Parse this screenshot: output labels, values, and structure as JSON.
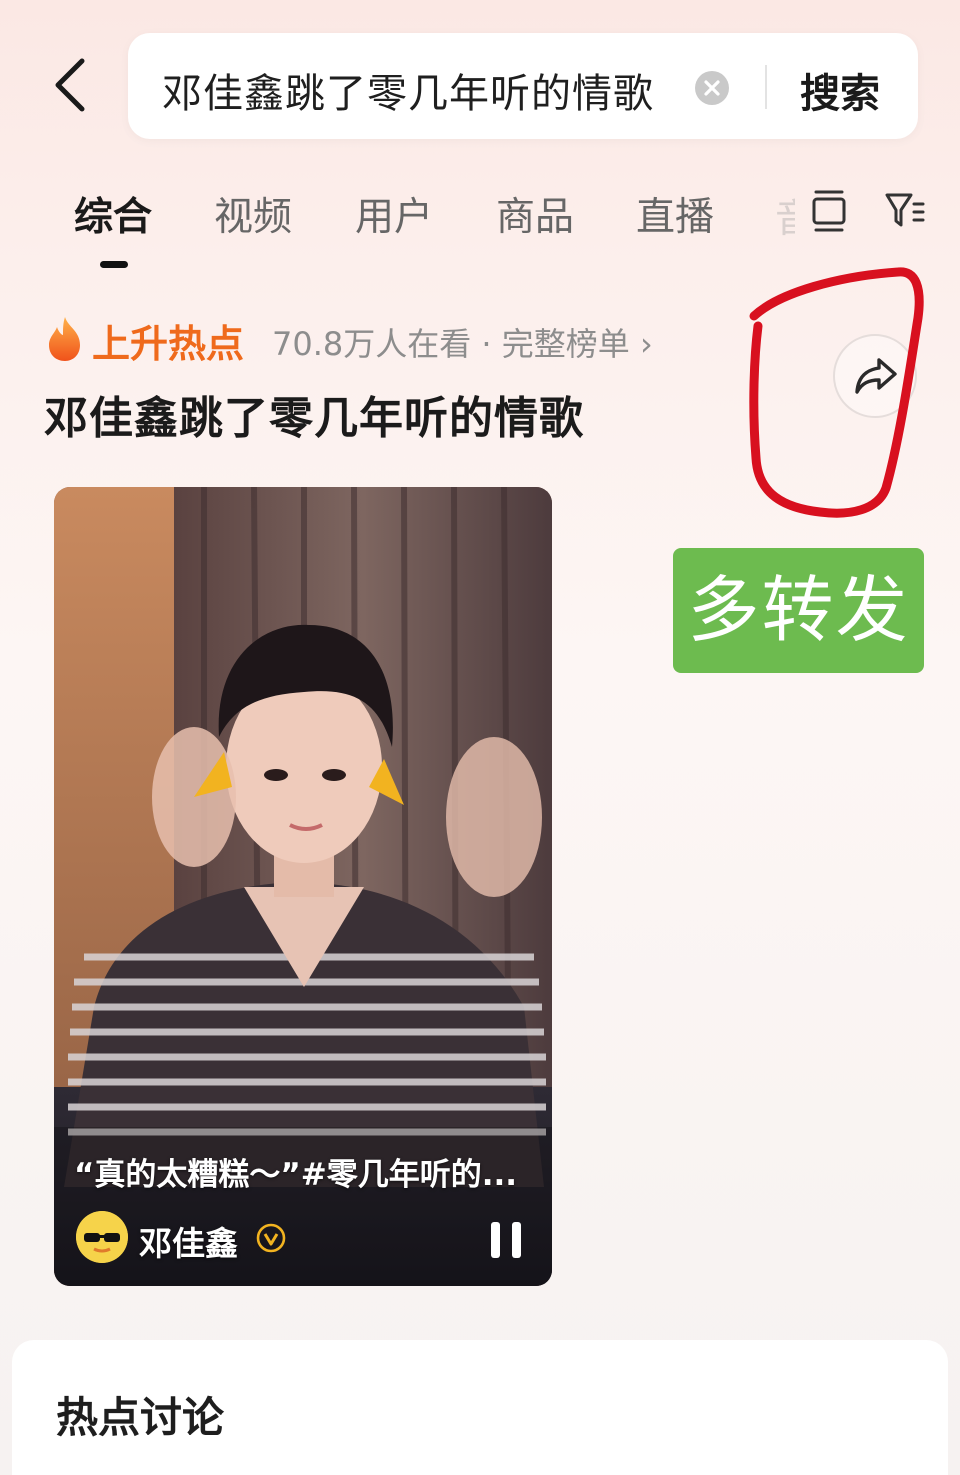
{
  "search": {
    "query": "邓佳鑫跳了零几年听的情歌",
    "submit_label": "搜索"
  },
  "tabs": [
    {
      "label": "综合",
      "active": true
    },
    {
      "label": "视频",
      "active": false
    },
    {
      "label": "用户",
      "active": false
    },
    {
      "label": "商品",
      "active": false
    },
    {
      "label": "直播",
      "active": false
    },
    {
      "label": "音",
      "active": false
    }
  ],
  "hot_topic": {
    "badge": "上升热点",
    "viewers": "70.8万人在看 · 完整榜单 ›",
    "title": "邓佳鑫跳了零几年听的情歌"
  },
  "annotation": {
    "repost_text": "多转发",
    "repost_bg": "#6dbb4f",
    "circle_color": "#d8101f"
  },
  "video": {
    "caption": "“真的太糟糕～”#零几年听的...",
    "author": "邓佳鑫"
  },
  "discussion": {
    "title": "热点讨论"
  },
  "icons": [
    "back-icon",
    "clear-icon",
    "layout-icon",
    "filter-icon",
    "flame-icon",
    "share-icon",
    "verified-icon",
    "pause-icon"
  ],
  "colors": {
    "accent_orange": "#ef6a1c",
    "text_primary": "#1b1b1b",
    "text_secondary": "#8d8d8d"
  }
}
